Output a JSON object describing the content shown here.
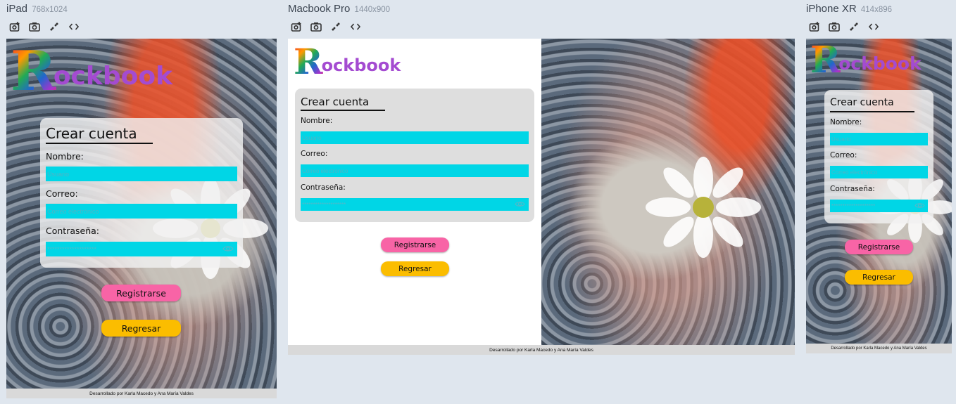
{
  "devices": [
    {
      "name": "iPad",
      "dims": "768x1024"
    },
    {
      "name": "Macbook Pro",
      "dims": "1440x900"
    },
    {
      "name": "iPhone XR",
      "dims": "414x896"
    }
  ],
  "toolbar_icons": [
    "screenshot-icon",
    "camera-icon",
    "rotate-icon",
    "code-icon"
  ],
  "app": {
    "logo_letter": "R",
    "logo_rest": "ockbook",
    "form_title": "Crear cuenta",
    "name_label": "Nombre:",
    "name_placeholder": "Usuario",
    "email_label": "Correo:",
    "email_placeholder": "Correo electrónico",
    "password_label": "Contraseña:",
    "password_value": "********************",
    "register_button": "Registrarse",
    "back_button": "Regresar",
    "footer": "Desarrollado por Karla Macedo y Ana María Valdes"
  },
  "colors": {
    "logo_purple": "#a44bd1",
    "input_cyan": "#00d6e6",
    "register_pink": "#f864a6",
    "back_yellow": "#fbbd00",
    "footer_gray": "#d9d9d9"
  }
}
